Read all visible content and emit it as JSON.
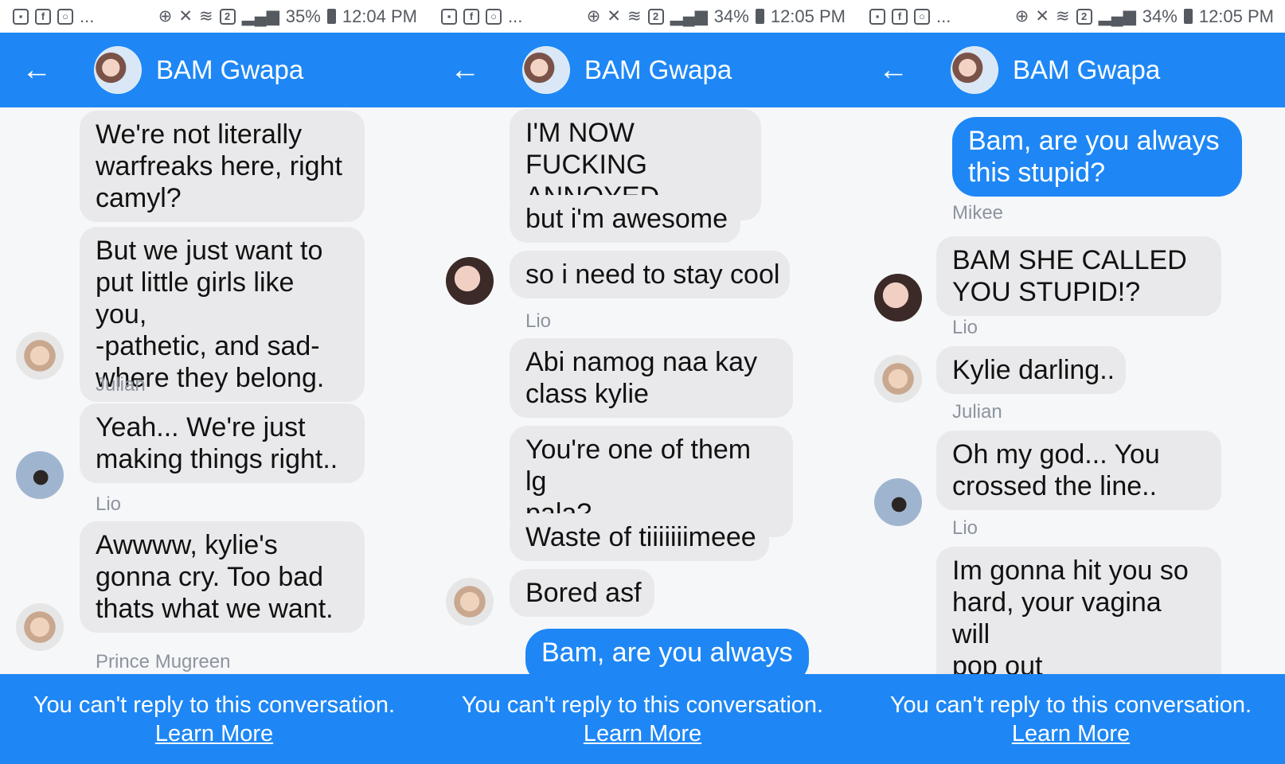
{
  "colors": {
    "accent": "#1e87f5",
    "incoming_bubble": "#e9e9eb",
    "background": "#f6f7f9",
    "sender_label": "#8d949e"
  },
  "panels": [
    {
      "status": {
        "left_icons": [
          "gallery-icon",
          "facebook-icon",
          "instagram-icon"
        ],
        "more": "...",
        "battery": "35%",
        "time": "12:04 PM",
        "sim": "2"
      },
      "header": {
        "title": "BAM Gwapa",
        "back_icon": "back-arrow-icon"
      },
      "footer": {
        "notice": "You can't reply to this conversation.",
        "link": "Learn More"
      },
      "messages": [
        {
          "text": "We're not literally\nwarfreaks here, right\ncamyl?"
        },
        {
          "text": "But we just want to\nput little girls like you,\n-pathetic, and sad-\nwhere they belong."
        },
        {
          "sender": "Julian"
        },
        {
          "text": "Yeah... We're just\nmaking things right.."
        },
        {
          "sender": "Lio"
        },
        {
          "text": "Awwww, kylie's\ngonna cry. Too bad\nthats what we want."
        },
        {
          "sender": "Prince Mugreen"
        }
      ]
    },
    {
      "status": {
        "left_icons": [
          "gallery-icon",
          "facebook-icon",
          "instagram-icon"
        ],
        "more": "...",
        "battery": "34%",
        "time": "12:05 PM",
        "sim": "2"
      },
      "header": {
        "title": "BAM Gwapa",
        "back_icon": "back-arrow-icon"
      },
      "footer": {
        "notice": "You can't reply to this conversation.",
        "link": "Learn More"
      },
      "messages": [
        {
          "text": "I'M NOW FUCKING\nANNOYED"
        },
        {
          "text": "but i'm awesome"
        },
        {
          "text": "so i need to stay cool"
        },
        {
          "sender": "Lio"
        },
        {
          "text": "Abi namog naa kay\nclass kylie"
        },
        {
          "text": "You're one of them lg\npala?"
        },
        {
          "text": "Waste of tiiiiiiimeee"
        },
        {
          "text": "Bored asf"
        },
        {
          "text": "Bam, are you always"
        }
      ]
    },
    {
      "status": {
        "left_icons": [
          "gallery-icon",
          "facebook-icon",
          "instagram-icon"
        ],
        "more": "...",
        "battery": "34%",
        "time": "12:05 PM",
        "sim": "2"
      },
      "header": {
        "title": "BAM Gwapa",
        "back_icon": "back-arrow-icon"
      },
      "footer": {
        "notice": "You can't reply to this conversation.",
        "link": "Learn More"
      },
      "messages": [
        {
          "text": "Bam, are you always\nthis stupid?"
        },
        {
          "sender": "Mikee"
        },
        {
          "text": "BAM SHE CALLED\nYOU STUPID!?"
        },
        {
          "sender": "Lio"
        },
        {
          "text": "Kylie darling.."
        },
        {
          "sender": "Julian"
        },
        {
          "text": "Oh my god... You\ncrossed the line.."
        },
        {
          "sender": "Lio"
        },
        {
          "text": "Im gonna hit you so\nhard, your vagina will\npop out"
        }
      ]
    }
  ]
}
